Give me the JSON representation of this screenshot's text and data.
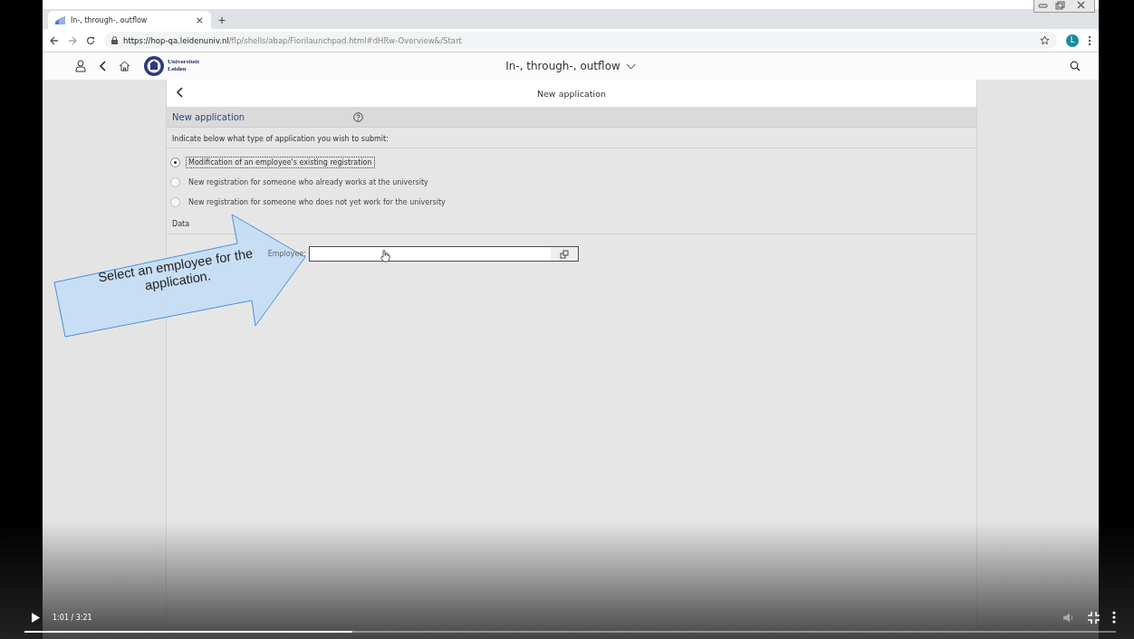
{
  "browser": {
    "tab_title": "In-, through-, outflow",
    "tab_close": "×",
    "new_tab": "+",
    "url": {
      "host": "https://hop-qa.leidenuniv.nl",
      "path": "/flp/shells/abap/Fiorilaunchpad.html#dHRw-Overview&/Start"
    },
    "avatar": "L"
  },
  "shell": {
    "logo_line_1": "Universiteit",
    "logo_line_2": "Leiden",
    "title": "In-, through-, outflow"
  },
  "page": {
    "header_title": "New application",
    "section_title": "New application",
    "instruction": "Indicate below what type of application you wish to submit:",
    "options": [
      {
        "label": "Modification of an employee's existing registration",
        "selected": true
      },
      {
        "label": "New registration for someone who already works at the university",
        "selected": false
      },
      {
        "label": "New registration for someone who does not yet work for the university",
        "selected": false
      }
    ],
    "data_heading": "Data",
    "employee_label": "Employee:"
  },
  "callout": {
    "text": "Select an employee for the application."
  },
  "video": {
    "time": "1:01 / 3:21",
    "level": 0.3
  }
}
